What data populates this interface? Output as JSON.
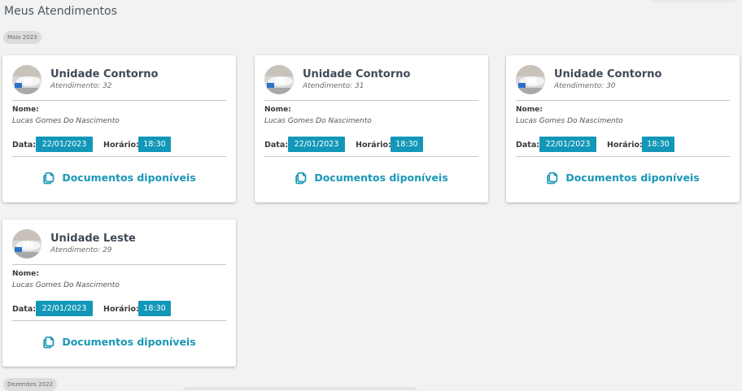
{
  "page_title": "Meus Atendimentos",
  "groups": [
    {
      "month": "Maio 2023",
      "cards": [
        {
          "unit": "Unidade Contorno",
          "atendimento": "Atendimento: 32",
          "nome_label": "Nome:",
          "nome": "Lucas Gomes Do Nascimento",
          "data_label": "Data:",
          "data": "22/01/2023",
          "horario_label": "Horário:",
          "horario": "18:30",
          "docs_label": "Documentos diponíveis"
        },
        {
          "unit": "Unidade Contorno",
          "atendimento": "Atendimento: 31",
          "nome_label": "Nome:",
          "nome": "Lucas Gomes Do Nascimento",
          "data_label": "Data:",
          "data": "22/01/2023",
          "horario_label": "Horário:",
          "horario": "18:30",
          "docs_label": "Documentos diponíveis"
        },
        {
          "unit": "Unidade Contorno",
          "atendimento": "Atendimento: 30",
          "nome_label": "Nome:",
          "nome": "Lucas Gomes Do Nascimento",
          "data_label": "Data:",
          "data": "22/01/2023",
          "horario_label": "Horário:",
          "horario": "18:30",
          "docs_label": "Documentos diponíveis"
        },
        {
          "unit": "Unidade Leste",
          "atendimento": "Atendimento: 29",
          "nome_label": "Nome:",
          "nome": "Lucas Gomes Do Nascimento",
          "data_label": "Data:",
          "data": "22/01/2023",
          "horario_label": "Horário:",
          "horario": "18:30",
          "docs_label": "Documentos diponíveis"
        }
      ]
    },
    {
      "month": "Dezembro 2022",
      "cards": []
    }
  ],
  "colors": {
    "accent": "#1397b8",
    "link": "#1a97b6",
    "background": "#f2f2f2"
  },
  "icons": {
    "avatar": "unit-photo-avatar",
    "docs": "copy-documents-icon"
  }
}
